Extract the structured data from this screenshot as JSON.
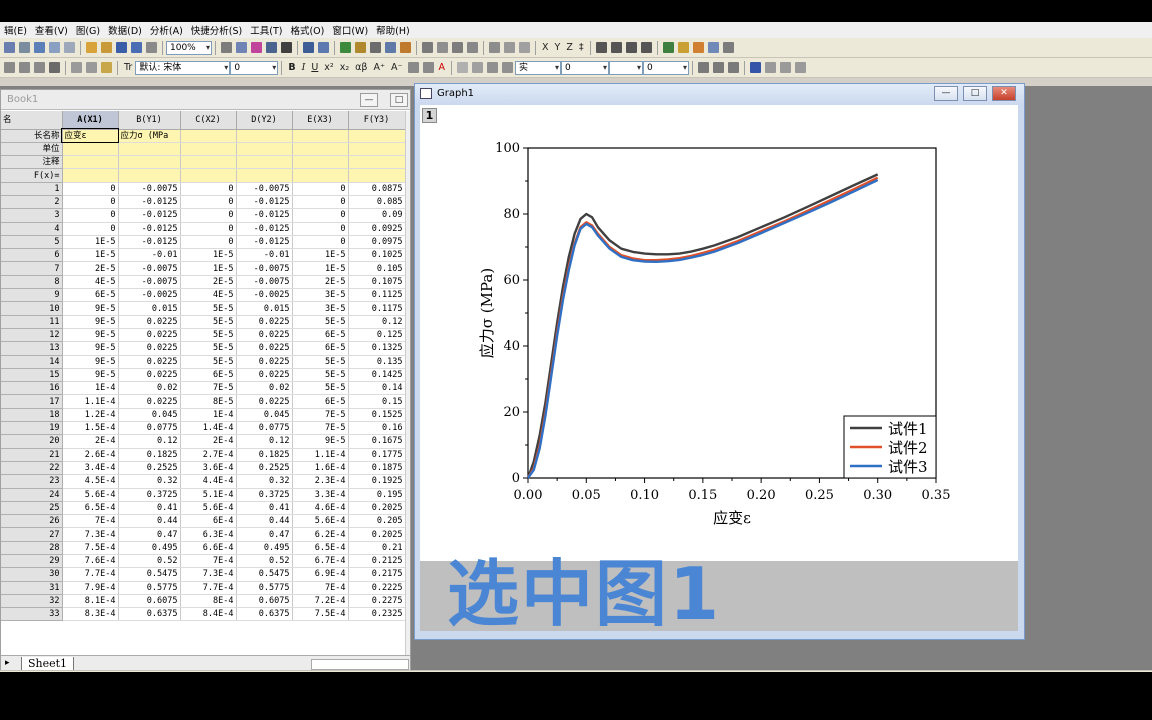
{
  "menu": [
    "辑(E)",
    "查看(V)",
    "图(G)",
    "数据(D)",
    "分析(A)",
    "快捷分析(S)",
    "工具(T)",
    "格式(O)",
    "窗口(W)",
    "帮助(H)"
  ],
  "toolbar": {
    "zoom": "100%",
    "font": "默认: 宋体",
    "font_size": "0",
    "line_style": "实",
    "val1": "0",
    "val2": "0",
    "bottom_size": "10",
    "font_prefix": "Tr"
  },
  "workbook": {
    "title": "Book1",
    "corner_label": "名",
    "columns": [
      {
        "label": "A(X1)",
        "long_name": "应变ε"
      },
      {
        "label": "B(Y1)",
        "long_name": "应力σ (MPa"
      },
      {
        "label": "C(X2)",
        "long_name": ""
      },
      {
        "label": "D(Y2)",
        "long_name": ""
      },
      {
        "label": "E(X3)",
        "long_name": ""
      },
      {
        "label": "F(Y3)",
        "long_name": ""
      }
    ],
    "meta_rows": [
      "长名称",
      "单位",
      "注释",
      "F(x)="
    ],
    "rows": [
      [
        "1",
        "0",
        "-0.0075",
        "0",
        "-0.0075",
        "0",
        "0.0875"
      ],
      [
        "2",
        "0",
        "-0.0125",
        "0",
        "-0.0125",
        "0",
        "0.085"
      ],
      [
        "3",
        "0",
        "-0.0125",
        "0",
        "-0.0125",
        "0",
        "0.09"
      ],
      [
        "4",
        "0",
        "-0.0125",
        "0",
        "-0.0125",
        "0",
        "0.0925"
      ],
      [
        "5",
        "1E-5",
        "-0.0125",
        "0",
        "-0.0125",
        "0",
        "0.0975"
      ],
      [
        "6",
        "1E-5",
        "-0.01",
        "1E-5",
        "-0.01",
        "1E-5",
        "0.1025"
      ],
      [
        "7",
        "2E-5",
        "-0.0075",
        "1E-5",
        "-0.0075",
        "1E-5",
        "0.105"
      ],
      [
        "8",
        "4E-5",
        "-0.0075",
        "2E-5",
        "-0.0075",
        "2E-5",
        "0.1075"
      ],
      [
        "9",
        "6E-5",
        "-0.0025",
        "4E-5",
        "-0.0025",
        "3E-5",
        "0.1125"
      ],
      [
        "10",
        "9E-5",
        "0.015",
        "5E-5",
        "0.015",
        "3E-5",
        "0.1175"
      ],
      [
        "11",
        "9E-5",
        "0.0225",
        "5E-5",
        "0.0225",
        "5E-5",
        "0.12"
      ],
      [
        "12",
        "9E-5",
        "0.0225",
        "5E-5",
        "0.0225",
        "6E-5",
        "0.125"
      ],
      [
        "13",
        "9E-5",
        "0.0225",
        "5E-5",
        "0.0225",
        "6E-5",
        "0.1325"
      ],
      [
        "14",
        "9E-5",
        "0.0225",
        "5E-5",
        "0.0225",
        "5E-5",
        "0.135"
      ],
      [
        "15",
        "9E-5",
        "0.0225",
        "6E-5",
        "0.0225",
        "5E-5",
        "0.1425"
      ],
      [
        "16",
        "1E-4",
        "0.02",
        "7E-5",
        "0.02",
        "5E-5",
        "0.14"
      ],
      [
        "17",
        "1.1E-4",
        "0.0225",
        "8E-5",
        "0.0225",
        "6E-5",
        "0.15"
      ],
      [
        "18",
        "1.2E-4",
        "0.045",
        "1E-4",
        "0.045",
        "7E-5",
        "0.1525"
      ],
      [
        "19",
        "1.5E-4",
        "0.0775",
        "1.4E-4",
        "0.0775",
        "7E-5",
        "0.16"
      ],
      [
        "20",
        "2E-4",
        "0.12",
        "2E-4",
        "0.12",
        "9E-5",
        "0.1675"
      ],
      [
        "21",
        "2.6E-4",
        "0.1825",
        "2.7E-4",
        "0.1825",
        "1.1E-4",
        "0.1775"
      ],
      [
        "22",
        "3.4E-4",
        "0.2525",
        "3.6E-4",
        "0.2525",
        "1.6E-4",
        "0.1875"
      ],
      [
        "23",
        "4.5E-4",
        "0.32",
        "4.4E-4",
        "0.32",
        "2.3E-4",
        "0.1925"
      ],
      [
        "24",
        "5.6E-4",
        "0.3725",
        "5.1E-4",
        "0.3725",
        "3.3E-4",
        "0.195"
      ],
      [
        "25",
        "6.5E-4",
        "0.41",
        "5.6E-4",
        "0.41",
        "4.6E-4",
        "0.2025"
      ],
      [
        "26",
        "7E-4",
        "0.44",
        "6E-4",
        "0.44",
        "5.6E-4",
        "0.205"
      ],
      [
        "27",
        "7.3E-4",
        "0.47",
        "6.3E-4",
        "0.47",
        "6.2E-4",
        "0.2025"
      ],
      [
        "28",
        "7.5E-4",
        "0.495",
        "6.6E-4",
        "0.495",
        "6.5E-4",
        "0.21"
      ],
      [
        "29",
        "7.6E-4",
        "0.52",
        "7E-4",
        "0.52",
        "6.7E-4",
        "0.2125"
      ],
      [
        "30",
        "7.7E-4",
        "0.5475",
        "7.3E-4",
        "0.5475",
        "6.9E-4",
        "0.2175"
      ],
      [
        "31",
        "7.9E-4",
        "0.5775",
        "7.7E-4",
        "0.5775",
        "7E-4",
        "0.2225"
      ],
      [
        "32",
        "8.1E-4",
        "0.6075",
        "8E-4",
        "0.6075",
        "7.2E-4",
        "0.2275"
      ],
      [
        "33",
        "8.3E-4",
        "0.6375",
        "8.4E-4",
        "0.6375",
        "7.5E-4",
        "0.2325"
      ]
    ],
    "sheet_tab": "Sheet1"
  },
  "graph_window": {
    "title": "Graph1",
    "layer": "1"
  },
  "caption": "选中图1",
  "chart_data": {
    "type": "line",
    "xlabel": "应变ε",
    "ylabel": "应力σ (MPa)",
    "xlim": [
      0,
      0.35
    ],
    "ylim": [
      0,
      100
    ],
    "xticks": [
      "0.00",
      "0.05",
      "0.10",
      "0.15",
      "0.20",
      "0.25",
      "0.30",
      "0.35"
    ],
    "yticks": [
      "0",
      "20",
      "40",
      "60",
      "80",
      "100"
    ],
    "legend_position": "bottom-right",
    "series": [
      {
        "name": "试件1",
        "color": "#404040",
        "x": [
          0,
          0.005,
          0.01,
          0.015,
          0.02,
          0.025,
          0.03,
          0.035,
          0.04,
          0.045,
          0.05,
          0.055,
          0.06,
          0.07,
          0.08,
          0.09,
          0.1,
          0.11,
          0.12,
          0.13,
          0.14,
          0.15,
          0.16,
          0.18,
          0.2,
          0.22,
          0.24,
          0.26,
          0.28,
          0.3
        ],
        "y": [
          0,
          5,
          13,
          23,
          35,
          47,
          58,
          67,
          74,
          78.5,
          80,
          79,
          76,
          72,
          69.5,
          68.5,
          68,
          67.8,
          67.8,
          68,
          68.6,
          69.5,
          70.5,
          73,
          76,
          79,
          82.2,
          85.5,
          88.8,
          92
        ]
      },
      {
        "name": "试件2",
        "color": "#e0502a",
        "x": [
          0,
          0.005,
          0.01,
          0.015,
          0.02,
          0.025,
          0.03,
          0.035,
          0.04,
          0.045,
          0.05,
          0.055,
          0.06,
          0.07,
          0.08,
          0.09,
          0.1,
          0.11,
          0.12,
          0.13,
          0.14,
          0.15,
          0.16,
          0.18,
          0.2,
          0.22,
          0.24,
          0.26,
          0.28,
          0.3
        ],
        "y": [
          0,
          3,
          10,
          20,
          32,
          44,
          55,
          64,
          71,
          76,
          77.5,
          76.5,
          74,
          70,
          67.5,
          66.5,
          66,
          66,
          66.2,
          66.6,
          67.3,
          68.2,
          69.2,
          71.8,
          74.8,
          77.8,
          81,
          84.3,
          87.6,
          91
        ]
      },
      {
        "name": "试件3",
        "color": "#2f6fc4",
        "x": [
          0,
          0.005,
          0.01,
          0.015,
          0.02,
          0.025,
          0.03,
          0.035,
          0.04,
          0.045,
          0.05,
          0.055,
          0.06,
          0.07,
          0.08,
          0.09,
          0.1,
          0.11,
          0.12,
          0.13,
          0.14,
          0.15,
          0.16,
          0.18,
          0.2,
          0.22,
          0.24,
          0.26,
          0.28,
          0.3
        ],
        "y": [
          0,
          2.5,
          9,
          19,
          31,
          43,
          54,
          63,
          70.5,
          75.5,
          77,
          76,
          73.5,
          69.5,
          67,
          66,
          65.6,
          65.5,
          65.7,
          66.1,
          66.8,
          67.6,
          68.6,
          71.2,
          74.2,
          77.3,
          80.4,
          83.6,
          86.9,
          90.3
        ]
      }
    ]
  }
}
